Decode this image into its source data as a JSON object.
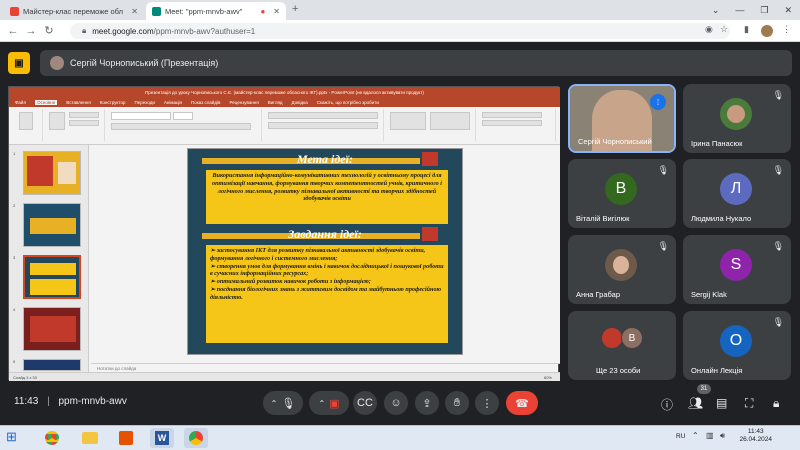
{
  "browser": {
    "tabs": [
      {
        "title": "Майстер-клас переможе обл",
        "icon_color": "#ea4335"
      },
      {
        "title": "Meet: \"ppm-mnvb-awv\"",
        "icon_color": "#00897b"
      }
    ],
    "url_host": "meet.google.com",
    "url_path": "/ppm-mnvb-awv?authuser=1"
  },
  "meet": {
    "presenter_label": "Сергій Чорнописький (Презентація)",
    "meeting_code": "ppm-mnvb-awv",
    "time": "11:43",
    "people_count": "31",
    "participants": [
      {
        "name": "Сергій Чорнописький",
        "type": "video",
        "speaking": true
      },
      {
        "name": "Ірина Панасюк",
        "type": "photo"
      },
      {
        "name": "Віталій Вигілюк",
        "type": "letter",
        "letter": "В",
        "color": "#33691e"
      },
      {
        "name": "Людмила Нукало",
        "type": "letter",
        "letter": "Л",
        "color": "#5c6bc0"
      },
      {
        "name": "Анна Грабар",
        "type": "photo"
      },
      {
        "name": "Sergij Klak",
        "type": "letter",
        "letter": "S",
        "color": "#8e24aa"
      },
      {
        "name": "Ще 23 особи",
        "type": "group",
        "letter": "В"
      },
      {
        "name": "Онлайн Лекція",
        "type": "letter",
        "letter": "О",
        "color": "#1565c0"
      }
    ]
  },
  "ppt": {
    "title": "Презентація до уроку Чорнописького С.Є. (майстер-клас переможе обласного ІКТ).pptx - PowerPoint (не вдалося активувати продукт)",
    "menu": [
      "Файл",
      "Основне",
      "Вставлення",
      "Конструктор",
      "Переходи",
      "Анімація",
      "Показ слайдів",
      "Рецензування",
      "Вигляд",
      "Довідка",
      "Скажіть, що потрібно зробити"
    ],
    "selected_menu": "Основне",
    "notes": "Нотатки до слайда",
    "status": "Слайд 3 з 33",
    "zoom": "60%",
    "slide": {
      "title1": "Мета ідеї:",
      "text1": "Використання інформаційно-комунікативних технологій у освітньому процесі для оптимізації навчання, формування творчих компетентностей учнів, критичного і логічного мислення, розвитку пізнавальної активності та творчих здібностей здобувачів освіти",
      "title2": "Завдання ідеї:",
      "bullets": [
        "застосування ІКТ для розвитку пізнавальної активності здобувачів освіти, формування логічного і системного мислення;",
        "створення умов для формування вмінь і навичок дослідницької і пошукової роботи в сучасних інформаційних ресурсах;",
        "оптимальний розвиток навичок роботи з інформацією;",
        "поєднання біологічних знань з життєвим досвідом та майбутньою професійною діяльністю."
      ]
    }
  },
  "taskbar": {
    "lang": "RU",
    "time": "11:43",
    "date": "26.04.2024"
  }
}
